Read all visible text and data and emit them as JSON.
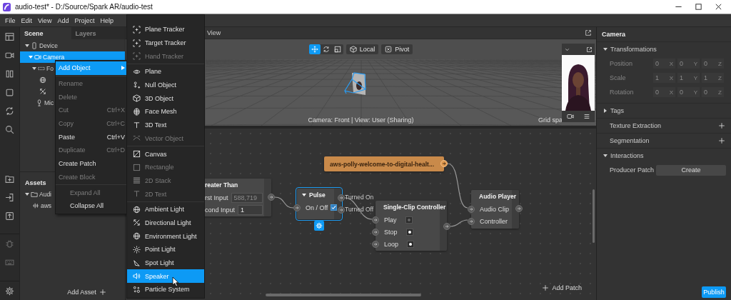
{
  "window": {
    "title": "audio-test* - D:/Source/Spark AR/audio-test"
  },
  "menu_bar": [
    "File",
    "Edit",
    "View",
    "Add",
    "Project",
    "Help"
  ],
  "scene_panel": {
    "tabs": [
      {
        "label": "Scene",
        "selected": true
      },
      {
        "label": "Layers",
        "selected": false
      }
    ],
    "tree": [
      {
        "label": "Device",
        "kind": "device",
        "selected": false,
        "expanded": true,
        "children": [
          {
            "label": "Camera",
            "kind": "camera",
            "selected": true,
            "expanded": true,
            "children": [
              {
                "label": "Fo",
                "kind": "face-tracker",
                "selected": false,
                "expanded": true,
                "children": [
                  {
                    "kind": "globe-light",
                    "selected": false
                  },
                  {
                    "kind": "directional-light",
                    "selected": false
                  }
                ]
              },
              {
                "label": "Mic",
                "kind": "microphone",
                "selected": false
              }
            ]
          }
        ]
      }
    ]
  },
  "assets_panel": {
    "title": "Assets",
    "tree": [
      {
        "label": "Audi",
        "kind": "folder",
        "selected": false,
        "expanded": true,
        "children": [
          {
            "label": "aws",
            "kind": "audio",
            "selected": false
          }
        ]
      }
    ],
    "add_button": "Add Asset"
  },
  "viewport": {
    "title": "View",
    "tools": [
      {
        "kind": "move",
        "selected": true
      },
      {
        "kind": "rotate",
        "selected": false
      },
      {
        "kind": "scale",
        "selected": false
      }
    ],
    "buttons": [
      {
        "kind": "local",
        "label": "Local"
      },
      {
        "kind": "pivot",
        "label": "Pivot"
      }
    ],
    "status": "Camera: Front | View: User (Sharing)",
    "grid_label": "Grid spa"
  },
  "patch_editor": {
    "nodes": [
      {
        "kind": "patch",
        "title": "reater Than",
        "selected": false,
        "inputs": [
          {
            "label": "rst Input",
            "kind": "number",
            "value": "588,719",
            "disabled": true
          },
          {
            "label": "cond Input",
            "kind": "number",
            "value": "1",
            "disabled": false
          }
        ]
      },
      {
        "kind": "patch",
        "title": "Pulse",
        "selected": true,
        "inputs": [
          {
            "label": "On / Off",
            "kind": "checkbox",
            "checked": true
          }
        ],
        "outputs": [
          "Turned On",
          "Turned Off"
        ]
      },
      {
        "kind": "asset",
        "title": "aws-polly-welcome-to-digital-healt...",
        "selected": false
      },
      {
        "kind": "patch",
        "title": "Single-Clip Controller",
        "selected": false,
        "inputs": [
          {
            "label": "Play",
            "kind": "trigger",
            "disabled": true
          },
          {
            "label": "Stop",
            "kind": "trigger",
            "disabled": false
          },
          {
            "label": "Loop",
            "kind": "trigger",
            "disabled": false
          }
        ]
      },
      {
        "kind": "patch",
        "title": "Audio Player",
        "selected": false,
        "inputs": [
          {
            "label": "Audio Clip",
            "kind": "port"
          },
          {
            "label": "Controller",
            "kind": "port"
          }
        ]
      }
    ],
    "add_patch": "Add Patch"
  },
  "inspector": {
    "title": "Camera",
    "sections": [
      {
        "kind": "group",
        "label": "Transformations",
        "expanded": true,
        "rows": [
          {
            "label": "Position",
            "disabled": true,
            "fields": [
              {
                "value": "0",
                "axis": "X"
              },
              {
                "value": "0",
                "axis": "Y"
              },
              {
                "value": "0",
                "axis": "Z"
              }
            ]
          },
          {
            "label": "Scale",
            "disabled": true,
            "fields": [
              {
                "value": "1",
                "axis": "X"
              },
              {
                "value": "1",
                "axis": "Y"
              },
              {
                "value": "1",
                "axis": "Z"
              }
            ]
          },
          {
            "label": "Rotation",
            "disabled": true,
            "fields": [
              {
                "value": "0",
                "axis": "X"
              },
              {
                "value": "0",
                "axis": "Y"
              },
              {
                "value": "0",
                "axis": "Z"
              }
            ]
          }
        ]
      },
      {
        "kind": "group",
        "label": "Tags",
        "expanded": false
      },
      {
        "kind": "add",
        "label": "Texture Extraction"
      },
      {
        "kind": "add",
        "label": "Segmentation"
      },
      {
        "kind": "group",
        "label": "Interactions",
        "expanded": true,
        "rows": [
          {
            "label": "Producer Patch",
            "disabled": false,
            "button": "Create"
          }
        ]
      }
    ],
    "publish_button": "Publish"
  },
  "context_menu": {
    "items": [
      {
        "label": "Add Object",
        "kind": "edit",
        "selected": true,
        "disabled": false,
        "submenu": true
      },
      {
        "label": "Rename",
        "kind": "edit",
        "selected": false,
        "disabled": true,
        "separator_before": true
      },
      {
        "label": "Delete",
        "kind": "edit",
        "selected": false,
        "disabled": true
      },
      {
        "label": "Cut",
        "kind": "edit",
        "selected": false,
        "disabled": true,
        "shortcut": "Ctrl+X"
      },
      {
        "label": "Copy",
        "kind": "edit",
        "selected": false,
        "disabled": true,
        "shortcut": "Ctrl+C"
      },
      {
        "label": "Paste",
        "kind": "edit",
        "selected": false,
        "disabled": false,
        "shortcut": "Ctrl+V"
      },
      {
        "label": "Duplicate",
        "kind": "edit",
        "selected": false,
        "disabled": true,
        "shortcut": "Ctrl+D"
      },
      {
        "label": "Create Patch",
        "kind": "edit",
        "selected": false,
        "disabled": false
      },
      {
        "label": "Create Block",
        "kind": "edit",
        "selected": false,
        "disabled": true
      },
      {
        "label": "Expand All",
        "kind": "tree",
        "selected": false,
        "disabled": true,
        "separator_before": true
      },
      {
        "label": "Collapse All",
        "kind": "tree",
        "selected": false,
        "disabled": false
      }
    ]
  },
  "submenu": {
    "items": [
      {
        "label": "Plane Tracker",
        "kind": "tracker",
        "selected": false,
        "disabled": false
      },
      {
        "label": "Target Tracker",
        "kind": "tracker",
        "selected": false,
        "disabled": false
      },
      {
        "label": "Hand Tracker",
        "kind": "tracker",
        "selected": false,
        "disabled": true
      },
      {
        "label": "Plane",
        "kind": "plane",
        "selected": false,
        "disabled": false,
        "separator_before": true
      },
      {
        "label": "Null Object",
        "kind": "null",
        "selected": false,
        "disabled": false
      },
      {
        "label": "3D Object",
        "kind": "object",
        "selected": false,
        "disabled": false
      },
      {
        "label": "Face Mesh",
        "kind": "mesh",
        "selected": false,
        "disabled": false
      },
      {
        "label": "3D Text",
        "kind": "text",
        "selected": false,
        "disabled": false
      },
      {
        "label": "Vector Object",
        "kind": "vector",
        "selected": false,
        "disabled": true
      },
      {
        "label": "Canvas",
        "kind": "canvas",
        "selected": false,
        "disabled": false,
        "separator_before": true
      },
      {
        "label": "Rectangle",
        "kind": "rectangle",
        "selected": false,
        "disabled": true
      },
      {
        "label": "2D Stack",
        "kind": "stack",
        "selected": false,
        "disabled": true
      },
      {
        "label": "2D Text",
        "kind": "text",
        "selected": false,
        "disabled": true
      },
      {
        "label": "Ambient Light",
        "kind": "globe-light",
        "selected": false,
        "disabled": false,
        "separator_before": true
      },
      {
        "label": "Directional Light",
        "kind": "directional-light",
        "selected": false,
        "disabled": false
      },
      {
        "label": "Environment Light",
        "kind": "globe-light",
        "selected": false,
        "disabled": false
      },
      {
        "label": "Point Light",
        "kind": "point-light",
        "selected": false,
        "disabled": false
      },
      {
        "label": "Spot Light",
        "kind": "spot-light",
        "selected": false,
        "disabled": false
      },
      {
        "label": "Speaker",
        "kind": "speaker",
        "selected": true,
        "disabled": false
      },
      {
        "label": "Particle System",
        "kind": "particle",
        "selected": false,
        "disabled": false
      }
    ]
  }
}
